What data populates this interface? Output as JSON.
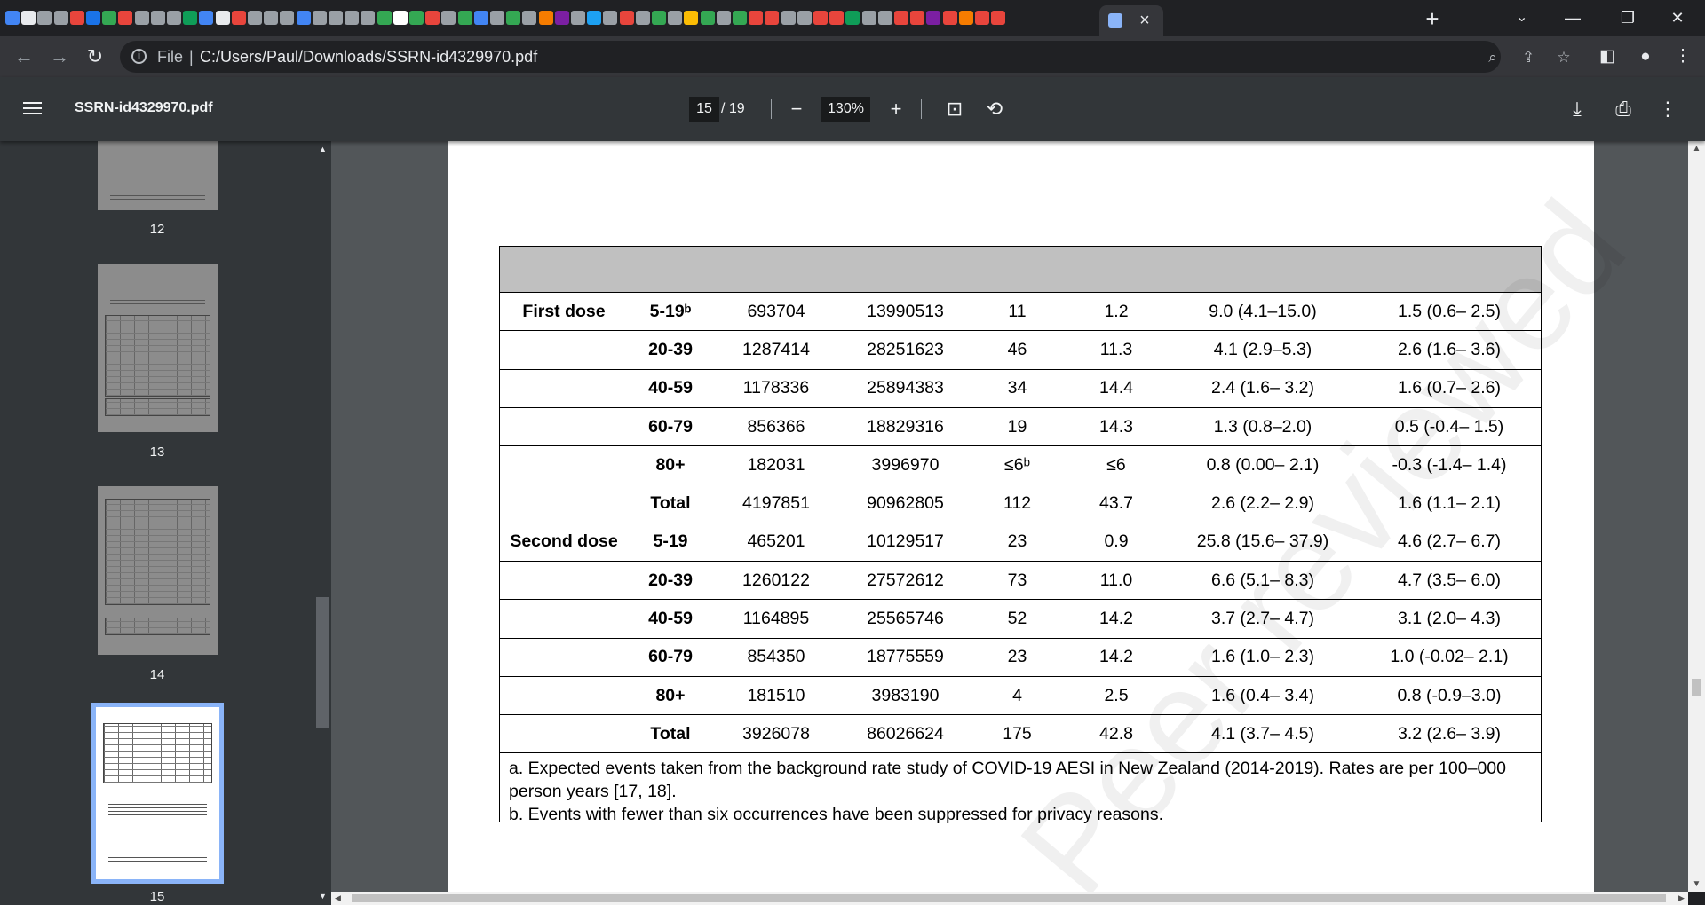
{
  "browser": {
    "active_tab_close": "×",
    "new_tab": "+",
    "tab_search": "⌄",
    "window": {
      "minimize": "—",
      "restore": "❐",
      "close": "✕"
    },
    "favicon_colors": [
      "#4285f4",
      "#e8eaed",
      "#9aa0a6",
      "#9aa0a6",
      "#e8453c",
      "#1a73e8",
      "#34a853",
      "#e8453c",
      "#9aa0a6",
      "#9aa0a6",
      "#9aa0a6",
      "#0f9d58",
      "#4285f4",
      "#e8eaed",
      "#e8453c",
      "#9aa0a6",
      "#9aa0a6",
      "#9aa0a6",
      "#4285f4",
      "#9aa0a6",
      "#9aa0a6",
      "#9aa0a6",
      "#9aa0a6",
      "#34a853",
      "#ffffff",
      "#34a853",
      "#e8453c",
      "#9aa0a6",
      "#34a853",
      "#4285f4",
      "#9aa0a6",
      "#34a853",
      "#9aa0a6",
      "#f57c00",
      "#7b1fa2",
      "#9aa0a6",
      "#1da1f2",
      "#9aa0a6",
      "#e8453c",
      "#9aa0a6",
      "#34a853",
      "#9aa0a6",
      "#fbbc04",
      "#34a853",
      "#9aa0a6",
      "#34a853",
      "#e8453c",
      "#e8453c",
      "#9aa0a6",
      "#9aa0a6",
      "#e8453c",
      "#e8453c",
      "#0f9d58",
      "#9aa0a6",
      "#9aa0a6",
      "#e8453c",
      "#e8453c",
      "#7b1fa2",
      "#e8453c",
      "#f57c00",
      "#e8453c",
      "#e8453c",
      "#e8453c",
      "#7b1fa2",
      "#4285f4",
      "#9aa0a6",
      "#e8453c",
      "#9aa0a6"
    ]
  },
  "omnibox": {
    "scheme_label": "File",
    "separator": "|",
    "url": "C:/Users/Paul/Downloads/SSRN-id4329970.pdf"
  },
  "pdf_toolbar": {
    "title": "SSRN-id4329970.pdf",
    "current_page": "15",
    "total_pages": "/ 19",
    "zoom": "130%"
  },
  "sidebar": {
    "thumbnails": [
      {
        "label": "12"
      },
      {
        "label": "13"
      },
      {
        "label": "14"
      },
      {
        "label": "15"
      }
    ]
  },
  "table": {
    "rows": [
      {
        "group": "First dose",
        "age": "5-19ᵇ",
        "c1": "693704",
        "c2": "13990513",
        "c3": "11",
        "c4": "1.2",
        "c5": "9.0 (4.1–15.0)",
        "c6": "1.5 (0.6– 2.5)"
      },
      {
        "group": "",
        "age": "20-39",
        "c1": "1287414",
        "c2": "28251623",
        "c3": "46",
        "c4": "11.3",
        "c5": "4.1 (2.9–5.3)",
        "c6": "2.6 (1.6– 3.6)"
      },
      {
        "group": "",
        "age": "40-59",
        "c1": "1178336",
        "c2": "25894383",
        "c3": "34",
        "c4": "14.4",
        "c5": "2.4 (1.6– 3.2)",
        "c6": "1.6 (0.7– 2.6)"
      },
      {
        "group": "",
        "age": "60-79",
        "c1": "856366",
        "c2": "18829316",
        "c3": "19",
        "c4": "14.3",
        "c5": "1.3 (0.8–2.0)",
        "c6": "0.5 (-0.4– 1.5)"
      },
      {
        "group": "",
        "age": "80+",
        "c1": "182031",
        "c2": "3996970",
        "c3": "≤6ᵇ",
        "c4": "≤6",
        "c5": "0.8 (0.00– 2.1)",
        "c6": "-0.3 (-1.4– 1.4)"
      },
      {
        "group": "",
        "age": "Total",
        "c1": "4197851",
        "c2": "90962805",
        "c3": "112",
        "c4": "43.7",
        "c5": "2.6 (2.2– 2.9)",
        "c6": "1.6 (1.1– 2.1)"
      },
      {
        "group": "Second dose",
        "age": "5-19",
        "c1": "465201",
        "c2": "10129517",
        "c3": "23",
        "c4": "0.9",
        "c5": "25.8 (15.6– 37.9)",
        "c6": "4.6 (2.7– 6.7)"
      },
      {
        "group": "",
        "age": "20-39",
        "c1": "1260122",
        "c2": "27572612",
        "c3": "73",
        "c4": "11.0",
        "c5": "6.6 (5.1– 8.3)",
        "c6": "4.7 (3.5– 6.0)"
      },
      {
        "group": "",
        "age": "40-59",
        "c1": "1164895",
        "c2": "25565746",
        "c3": "52",
        "c4": "14.2",
        "c5": "3.7 (2.7– 4.7)",
        "c6": "3.1 (2.0– 4.3)"
      },
      {
        "group": "",
        "age": "60-79",
        "c1": "854350",
        "c2": "18775559",
        "c3": "23",
        "c4": "14.2",
        "c5": "1.6 (1.0– 2.3)",
        "c6": "1.0 (-0.02– 2.1)"
      },
      {
        "group": "",
        "age": "80+",
        "c1": "181510",
        "c2": "3983190",
        "c3": "4",
        "c4": "2.5",
        "c5": "1.6 (0.4– 3.4)",
        "c6": "0.8 (-0.9–3.0)"
      },
      {
        "group": "",
        "age": "Total",
        "c1": "3926078",
        "c2": "86026624",
        "c3": "175",
        "c4": "42.8",
        "c5": "4.1 (3.7– 4.5)",
        "c6": "3.2 (2.6– 3.9)"
      }
    ],
    "note_a": "a. Expected events taken from the background rate study of COVID-19 AESI in New Zealand (2014-2019). Rates are per 100–000 person years [17, 18].",
    "note_b": "b. Events with fewer than six occurrences have been suppressed for privacy reasons."
  },
  "watermark": "Peer reviewed"
}
